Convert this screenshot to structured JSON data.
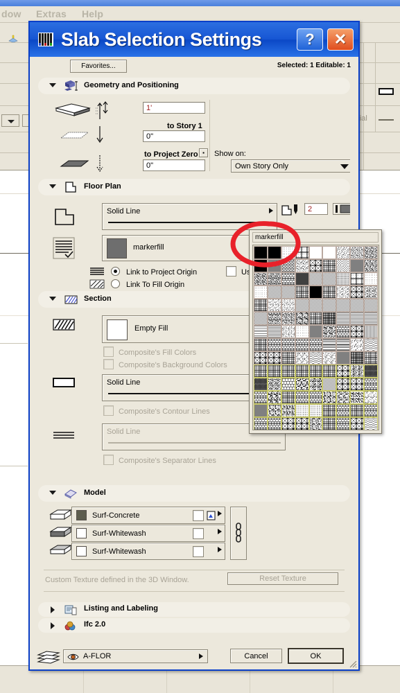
{
  "background": {
    "menus": [
      "dow",
      "Extras",
      "Help"
    ],
    "material_label": "terial"
  },
  "dialog": {
    "title": "Slab Selection Settings",
    "title_icon": "slab-settings-icon",
    "help_label": "?",
    "close_label": "✕",
    "favorites_label": "Favorites...",
    "selection_info": "Selected: 1 Editable: 1"
  },
  "geometry": {
    "title": "Geometry and Positioning",
    "icon": "geometry-icon",
    "arrow": "chevron-down-icon",
    "thickness_value": "1'",
    "to_story_label": "to Story 1",
    "story_offset_value": "0\"",
    "to_project_zero_label": "to Project Zero",
    "project_zero_value": "0\"",
    "show_on_label": "Show on:",
    "show_on_value": "Own Story Only",
    "more_button": "..."
  },
  "floor_plan": {
    "title": "Floor Plan",
    "icon": "floor-plan-icon",
    "line_type": "Solid Line",
    "pen_value": "2",
    "fill_name": "markerfill",
    "fill_swatch_color": "#6e6e6e",
    "link_project_origin": "Link to Project Origin",
    "link_fill_origin": "Link To Fill Origin",
    "use_fill_of_surface": "Use Fill of su",
    "selected_origin": "project"
  },
  "section": {
    "title": "Section",
    "icon": "section-hatch-icon",
    "fill_name": "Empty Fill",
    "composite_fill_colors": "Composite's Fill Colors",
    "composite_background_colors": "Composite's Background Colors",
    "contour_line": "Solid Line",
    "composite_contour_lines": "Composite's Contour Lines",
    "separator_line": "Solid Line",
    "composite_separator_lines": "Composite's Separator Lines"
  },
  "model": {
    "title": "Model",
    "icon": "model-icon",
    "surfaces": [
      {
        "name": "Surf-Concrete",
        "swatch": "#5d5d4e"
      },
      {
        "name": "Surf-Whitewash",
        "swatch": "#ffffff"
      },
      {
        "name": "Surf-Whitewash",
        "swatch": "#ffffff"
      }
    ],
    "link_icon": "chain-link-icon",
    "custom_texture_note": "Custom Texture defined in the 3D Window.",
    "reset_texture_label": "Reset Texture"
  },
  "collapsed_sections": [
    {
      "title": "Listing and Labeling",
      "icon": "listing-icon"
    },
    {
      "title": "Ifc 2.0",
      "icon": "ifc-icon"
    }
  ],
  "footer": {
    "layer_icon": "layers-icon",
    "eye_icon": "eye-icon",
    "layer_value": "A-FLOR",
    "cancel_label": "Cancel",
    "ok_label": "OK"
  },
  "palette": {
    "name": "markerfill",
    "columns": 9,
    "rows": 14,
    "selected_index": 1,
    "annotation": "red-circle-annotation",
    "annotation_color": "#e8212a",
    "cells": [
      "solid-black",
      "solid-black",
      "dots-sparse",
      "dots-box",
      "empty-white",
      "empty-white",
      "stipple-fine",
      "stipple-med",
      "stipple-dark",
      "solid-black",
      "diag-fine-a",
      "brick-small",
      "hatch-cross-a",
      "cross-x",
      "mesh-a",
      "diag-wide",
      "diag-pair",
      "stipple-dark",
      "stipple-dark",
      "stipple-dark",
      "brick-row",
      "grid-dense",
      "diag-a",
      "diag-b",
      "vert-dash",
      "dots-box",
      "dots-sparse",
      "dots-sparse",
      "diag-c",
      "diag-d",
      "mesh-b",
      "solid-black",
      "mesh-c",
      "stipple-fine",
      "star-x",
      "stipple-med",
      "mesh-d",
      "stipple-fine",
      "stipple-fine",
      "diag-e",
      "diag-a",
      "diag-b",
      "diag-c",
      "diag-d",
      "diag-e",
      "diag-f",
      "stipple-rough",
      "stipple-rough",
      "stipple-rough",
      "mesh-e",
      "grid-fine",
      "lines-h",
      "lines-h",
      "lines-h",
      "lines-h-wide",
      "lines-h",
      "stipple-fine",
      "dots-sparse",
      "lines-h-dense",
      "stipple-rough",
      "brick-vert",
      "cross-x",
      "vert-bars",
      "grid-box",
      "bond-a",
      "bond-b",
      "bond-c",
      "bond-d",
      "half-h",
      "half-h",
      "dots-rough",
      "circles-a",
      "maze-a",
      "weave-a",
      "grid-plain",
      "stipple-fine",
      "wave-a",
      "stipple-fine",
      "lines-h-dense",
      "grid-fine",
      "plus-grid",
      "plus-grid",
      "plus-grid",
      "plus-grid",
      "plus-grid",
      "plus-grid",
      "plus-small",
      "cross-x",
      "stipple-dark",
      "diag-thick",
      "diag-thick",
      "rough-a",
      "brick-big",
      "rough-b",
      "scatter-a",
      "diag-g",
      "weave-b",
      "weave-c",
      "brick-stack",
      "brick-stack2",
      "rock-a",
      "grid-stone",
      "brick-mid",
      "brick-mid2",
      "rock-b",
      "rock-c",
      "stipple-rough",
      "dots-rough",
      "diag-rough",
      "stone-a",
      "stone-b",
      "dots-fine",
      "dots-fine",
      "grid-block",
      "brick-half",
      "grid-block2",
      "brick-cross",
      "block-a",
      "block-b",
      "cross-box",
      "maze-b",
      "rough-c",
      "grid-stone2",
      "brick-layer",
      "cross-circle",
      "wave-b",
      "grid-block3",
      "panel-a",
      "plus-box",
      "rough-d",
      "diag-x",
      "grid-col",
      "fence-a",
      "stone-c",
      "brick-wide",
      "rock-d",
      "weave-d",
      "wave-c"
    ]
  }
}
